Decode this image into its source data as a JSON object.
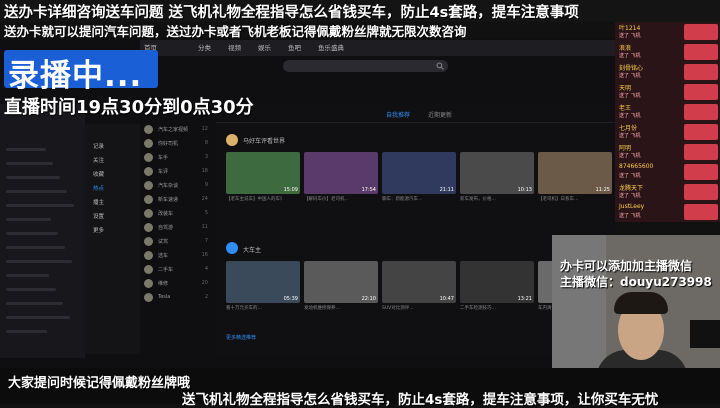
{
  "overlay": {
    "top_banner": "送办卡详细咨询送车问题  送飞机礼物全程指导怎么省钱买车，防止4s套路，提车注意事项",
    "sub_banner": "送办卡就可以提问汽车问题，送过办卡或者飞机老板记得佩戴粉丝牌就无限次数咨询",
    "recording": "录播中...",
    "live_time": "直播时间19点30分到0点30分",
    "wechat_line1": "办卡可以添加加主播微信",
    "wechat_line2": "主播微信：douyu273998",
    "hint": "大家提问时候记得佩戴粉丝牌哦",
    "bottom_ticker": "送飞机礼物全程指导怎么省钱买车，防止4s套路，提车注意事项，让你买车无忧"
  },
  "app": {
    "nav": [
      "首页",
      "分类",
      "视频",
      "娱乐",
      "鱼吧",
      "鱼乐盛典"
    ],
    "search_icon": "search-icon",
    "tabs": [
      "自我推荐",
      "近期更新"
    ],
    "mid_menu": [
      "记录",
      "关注",
      "收藏",
      "热点",
      "播主",
      "设置",
      "更多"
    ],
    "channels": [
      {
        "name": "汽车之家视频",
        "count": "12"
      },
      {
        "name": "你好司机",
        "count": "8"
      },
      {
        "name": "车手",
        "count": "3"
      },
      {
        "name": "车评",
        "count": "18"
      },
      {
        "name": "汽车杂谈",
        "count": "9"
      },
      {
        "name": "新车速递",
        "count": "24"
      },
      {
        "name": "改装车",
        "count": "5"
      },
      {
        "name": "自驾游",
        "count": "11"
      },
      {
        "name": "试驾",
        "count": "7"
      },
      {
        "name": "选车",
        "count": "16"
      },
      {
        "name": "二手车",
        "count": "4"
      },
      {
        "name": "维修",
        "count": "20"
      },
      {
        "name": "Tesla",
        "count": "2"
      }
    ],
    "row1_uploader": "马好车评看世界",
    "row1_videos": [
      {
        "dur": "15:09",
        "caption": "【老车主说车】中国人的车评…"
      },
      {
        "dur": "17:54",
        "caption": "【解码车价】老司机…"
      },
      {
        "dur": "21:11",
        "caption": "聊车：新能源汽车…"
      },
      {
        "dur": "10:13",
        "caption": "新车发布，价格…"
      },
      {
        "dur": "11:25",
        "caption": "【老司机】日系车…"
      }
    ],
    "row2_uploader": "大车主",
    "row2_videos": [
      {
        "dur": "05:39",
        "caption": "看十万元买车的…"
      },
      {
        "dur": "22:10",
        "caption": "发动机维修保养…"
      },
      {
        "dur": "10:47",
        "caption": "SUV对比测评…"
      },
      {
        "dur": "13:21",
        "caption": "二手车检测技巧…"
      },
      {
        "dur": "08:02",
        "caption": "车内清洁全攻略…"
      }
    ],
    "more_label": "更多精选推荐"
  },
  "chat": [
    {
      "name": "叶1214",
      "gift": "送了 飞机"
    },
    {
      "name": "浪浪",
      "gift": "送了 飞机"
    },
    {
      "name": "刻骨铭心",
      "gift": "送了 飞机"
    },
    {
      "name": "天明",
      "gift": "送了 飞机"
    },
    {
      "name": "老王",
      "gift": "送了 飞机"
    },
    {
      "name": "七月份",
      "gift": "送了 飞机"
    },
    {
      "name": "阿明",
      "gift": "送了 飞机"
    },
    {
      "name": "874665600",
      "gift": "送了 飞机"
    },
    {
      "name": "龙腾天下",
      "gift": "送了 飞机"
    },
    {
      "name": "JustLeey",
      "gift": "送了 飞机"
    }
  ],
  "colors": {
    "badge": "#1a5fd6",
    "accent": "#2f8cf0",
    "gift_bg": "#d23d4c"
  }
}
